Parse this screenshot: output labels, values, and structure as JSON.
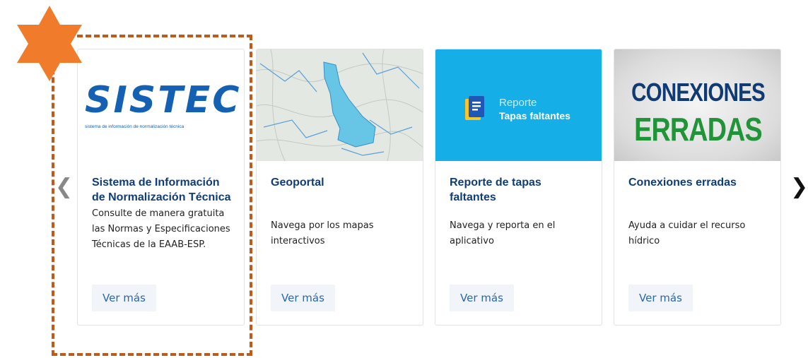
{
  "nav": {
    "prev_icon": "chevron-left-icon",
    "next_icon": "chevron-right-icon"
  },
  "annotation": {
    "color": "#c0591a",
    "star_color": "#f07c2b"
  },
  "cards": [
    {
      "title": "Sistema de Información de Normalización Técnica",
      "description": "Consulte de manera gratuita las Normas y Especificaciones Técnicas de la EAAB-ESP.",
      "button": "Ver más",
      "logo_text": "SISTEC",
      "logo_sub": "sistema de información de normalización técnica"
    },
    {
      "title": "Geoportal",
      "description": "Navega por los mapas interactivos",
      "button": "Ver más"
    },
    {
      "title": "Reporte de tapas faltantes",
      "description": "Navega y reporta en el aplicativo",
      "button": "Ver más",
      "banner_line1": "Reporte",
      "banner_line2": "Tapas faltantes"
    },
    {
      "title": "Conexiones erradas",
      "description": "Ayuda a cuidar el recurso hídrico",
      "button": "Ver más",
      "banner_line1": "CONEXIONES",
      "banner_line2": "ERRADAS"
    }
  ]
}
